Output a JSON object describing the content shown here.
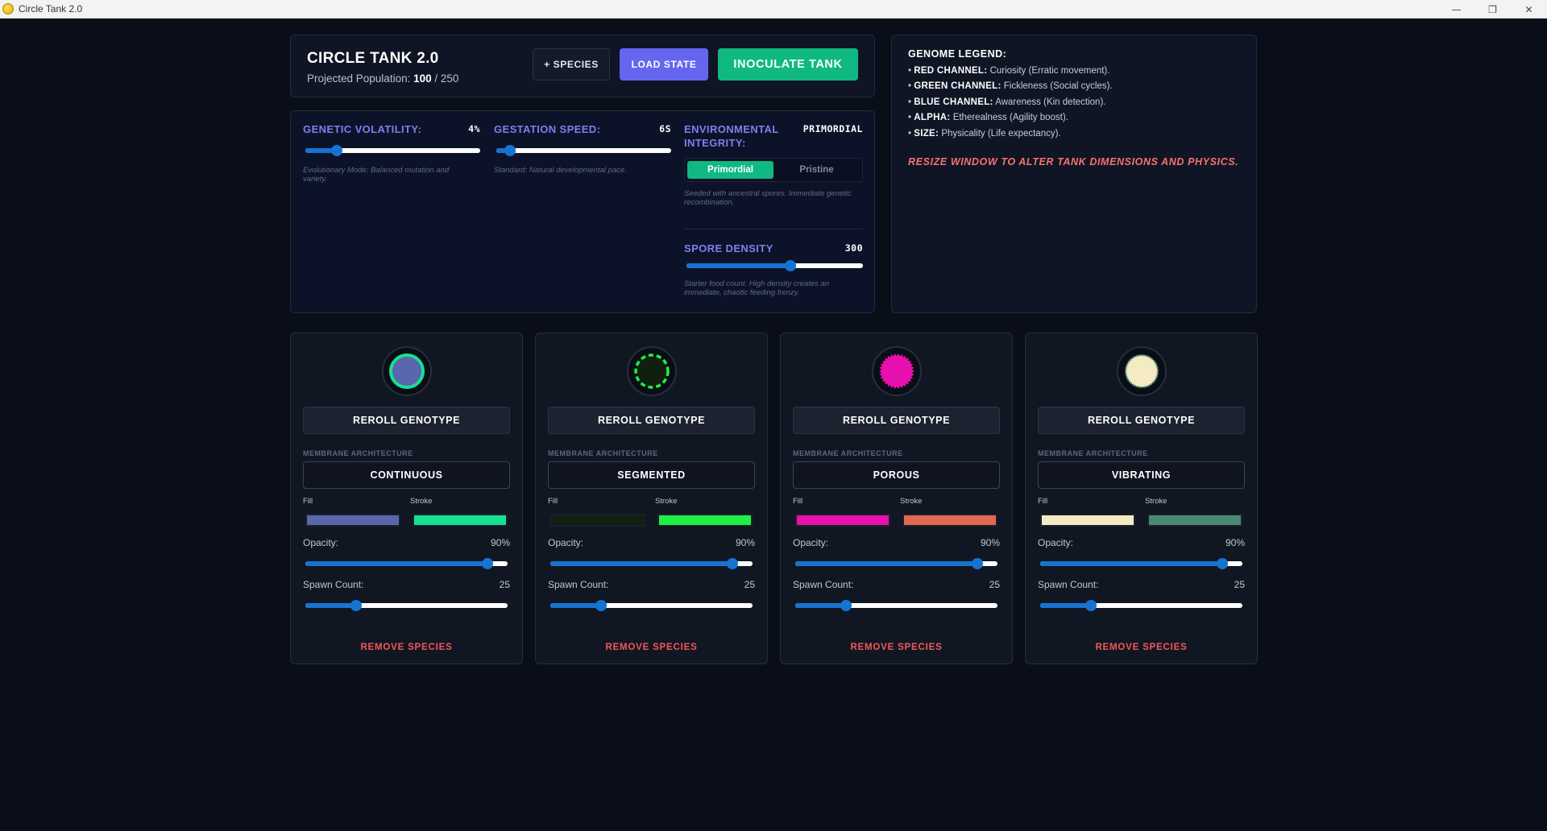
{
  "window": {
    "title": "Circle Tank 2.0",
    "controls": [
      "—",
      "❐",
      "✕"
    ]
  },
  "header": {
    "title": "CIRCLE TANK 2.0",
    "population_label": "Projected Population:",
    "population_current": "100",
    "population_max": "/ 250",
    "buttons": {
      "species": "+ SPECIES",
      "load": "LOAD STATE",
      "inoculate": "INOCULATE TANK"
    }
  },
  "settings": {
    "volatility": {
      "label": "GENETIC VOLATILITY:",
      "value": "4%",
      "level": 0.18,
      "hint": "Evolutionary Mode: Balanced mutation and variety."
    },
    "gestation": {
      "label": "GESTATION SPEED:",
      "value": "6S",
      "level": 0.08,
      "hint": "Standard: Natural developmental pace."
    },
    "environment": {
      "label": "ENVIRONMENTAL INTEGRITY:",
      "value": "PRIMORDIAL",
      "options": [
        "Primordial",
        "Pristine"
      ],
      "selected": "Primordial",
      "hint": "Seeded with ancestral spores. Immediate genetic recombination."
    },
    "spore": {
      "label": "SPORE DENSITY",
      "value": "300",
      "level": 0.59,
      "hint": "Starter food count. High density creates an immediate, chaotic feeding frenzy."
    }
  },
  "legend": {
    "title": "GENOME LEGEND:",
    "items": [
      {
        "key": "RED CHANNEL:",
        "desc": "Curiosity (Erratic movement)."
      },
      {
        "key": "GREEN CHANNEL:",
        "desc": "Fickleness (Social cycles)."
      },
      {
        "key": "BLUE CHANNEL:",
        "desc": "Awareness (Kin detection)."
      },
      {
        "key": "ALPHA:",
        "desc": "Etherealness (Agility boost)."
      },
      {
        "key": "SIZE:",
        "desc": "Physicality (Life expectancy)."
      }
    ],
    "warning": "RESIZE WINDOW TO ALTER TANK DIMENSIONS AND PHYSICS."
  },
  "species": [
    {
      "reroll": "REROLL GENOTYPE",
      "membrane_label": "MEMBRANE ARCHITECTURE",
      "membrane": "CONTINUOUS",
      "fill_label": "Fill",
      "stroke_label": "Stroke",
      "fill": "#5a66ad",
      "stroke": "#16e092",
      "opacity_label": "Opacity:",
      "opacity": "90%",
      "opacity_level": 0.9,
      "spawn_label": "Spawn Count:",
      "spawn": "25",
      "spawn_level": 0.25,
      "remove": "REMOVE SPECIES",
      "style": "continuous"
    },
    {
      "reroll": "REROLL GENOTYPE",
      "membrane_label": "MEMBRANE ARCHITECTURE",
      "membrane": "SEGMENTED",
      "fill_label": "Fill",
      "stroke_label": "Stroke",
      "fill": "#0f1f10",
      "stroke": "#1ff043",
      "opacity_label": "Opacity:",
      "opacity": "90%",
      "opacity_level": 0.9,
      "spawn_label": "Spawn Count:",
      "spawn": "25",
      "spawn_level": 0.25,
      "remove": "REMOVE SPECIES",
      "style": "segmented"
    },
    {
      "reroll": "REROLL GENOTYPE",
      "membrane_label": "MEMBRANE ARCHITECTURE",
      "membrane": "POROUS",
      "fill_label": "Fill",
      "stroke_label": "Stroke",
      "fill": "#e810ae",
      "stroke": "#e0694f",
      "opacity_label": "Opacity:",
      "opacity": "90%",
      "opacity_level": 0.9,
      "spawn_label": "Spawn Count:",
      "spawn": "25",
      "spawn_level": 0.25,
      "remove": "REMOVE SPECIES",
      "style": "porous"
    },
    {
      "reroll": "REROLL GENOTYPE",
      "membrane_label": "MEMBRANE ARCHITECTURE",
      "membrane": "VIBRATING",
      "fill_label": "Fill",
      "stroke_label": "Stroke",
      "fill": "#f4ebc2",
      "stroke": "#4a8974",
      "opacity_label": "Opacity:",
      "opacity": "90%",
      "opacity_level": 0.9,
      "spawn_label": "Spawn Count:",
      "spawn": "25",
      "spawn_level": 0.25,
      "remove": "REMOVE SPECIES",
      "style": "vibrating"
    }
  ]
}
